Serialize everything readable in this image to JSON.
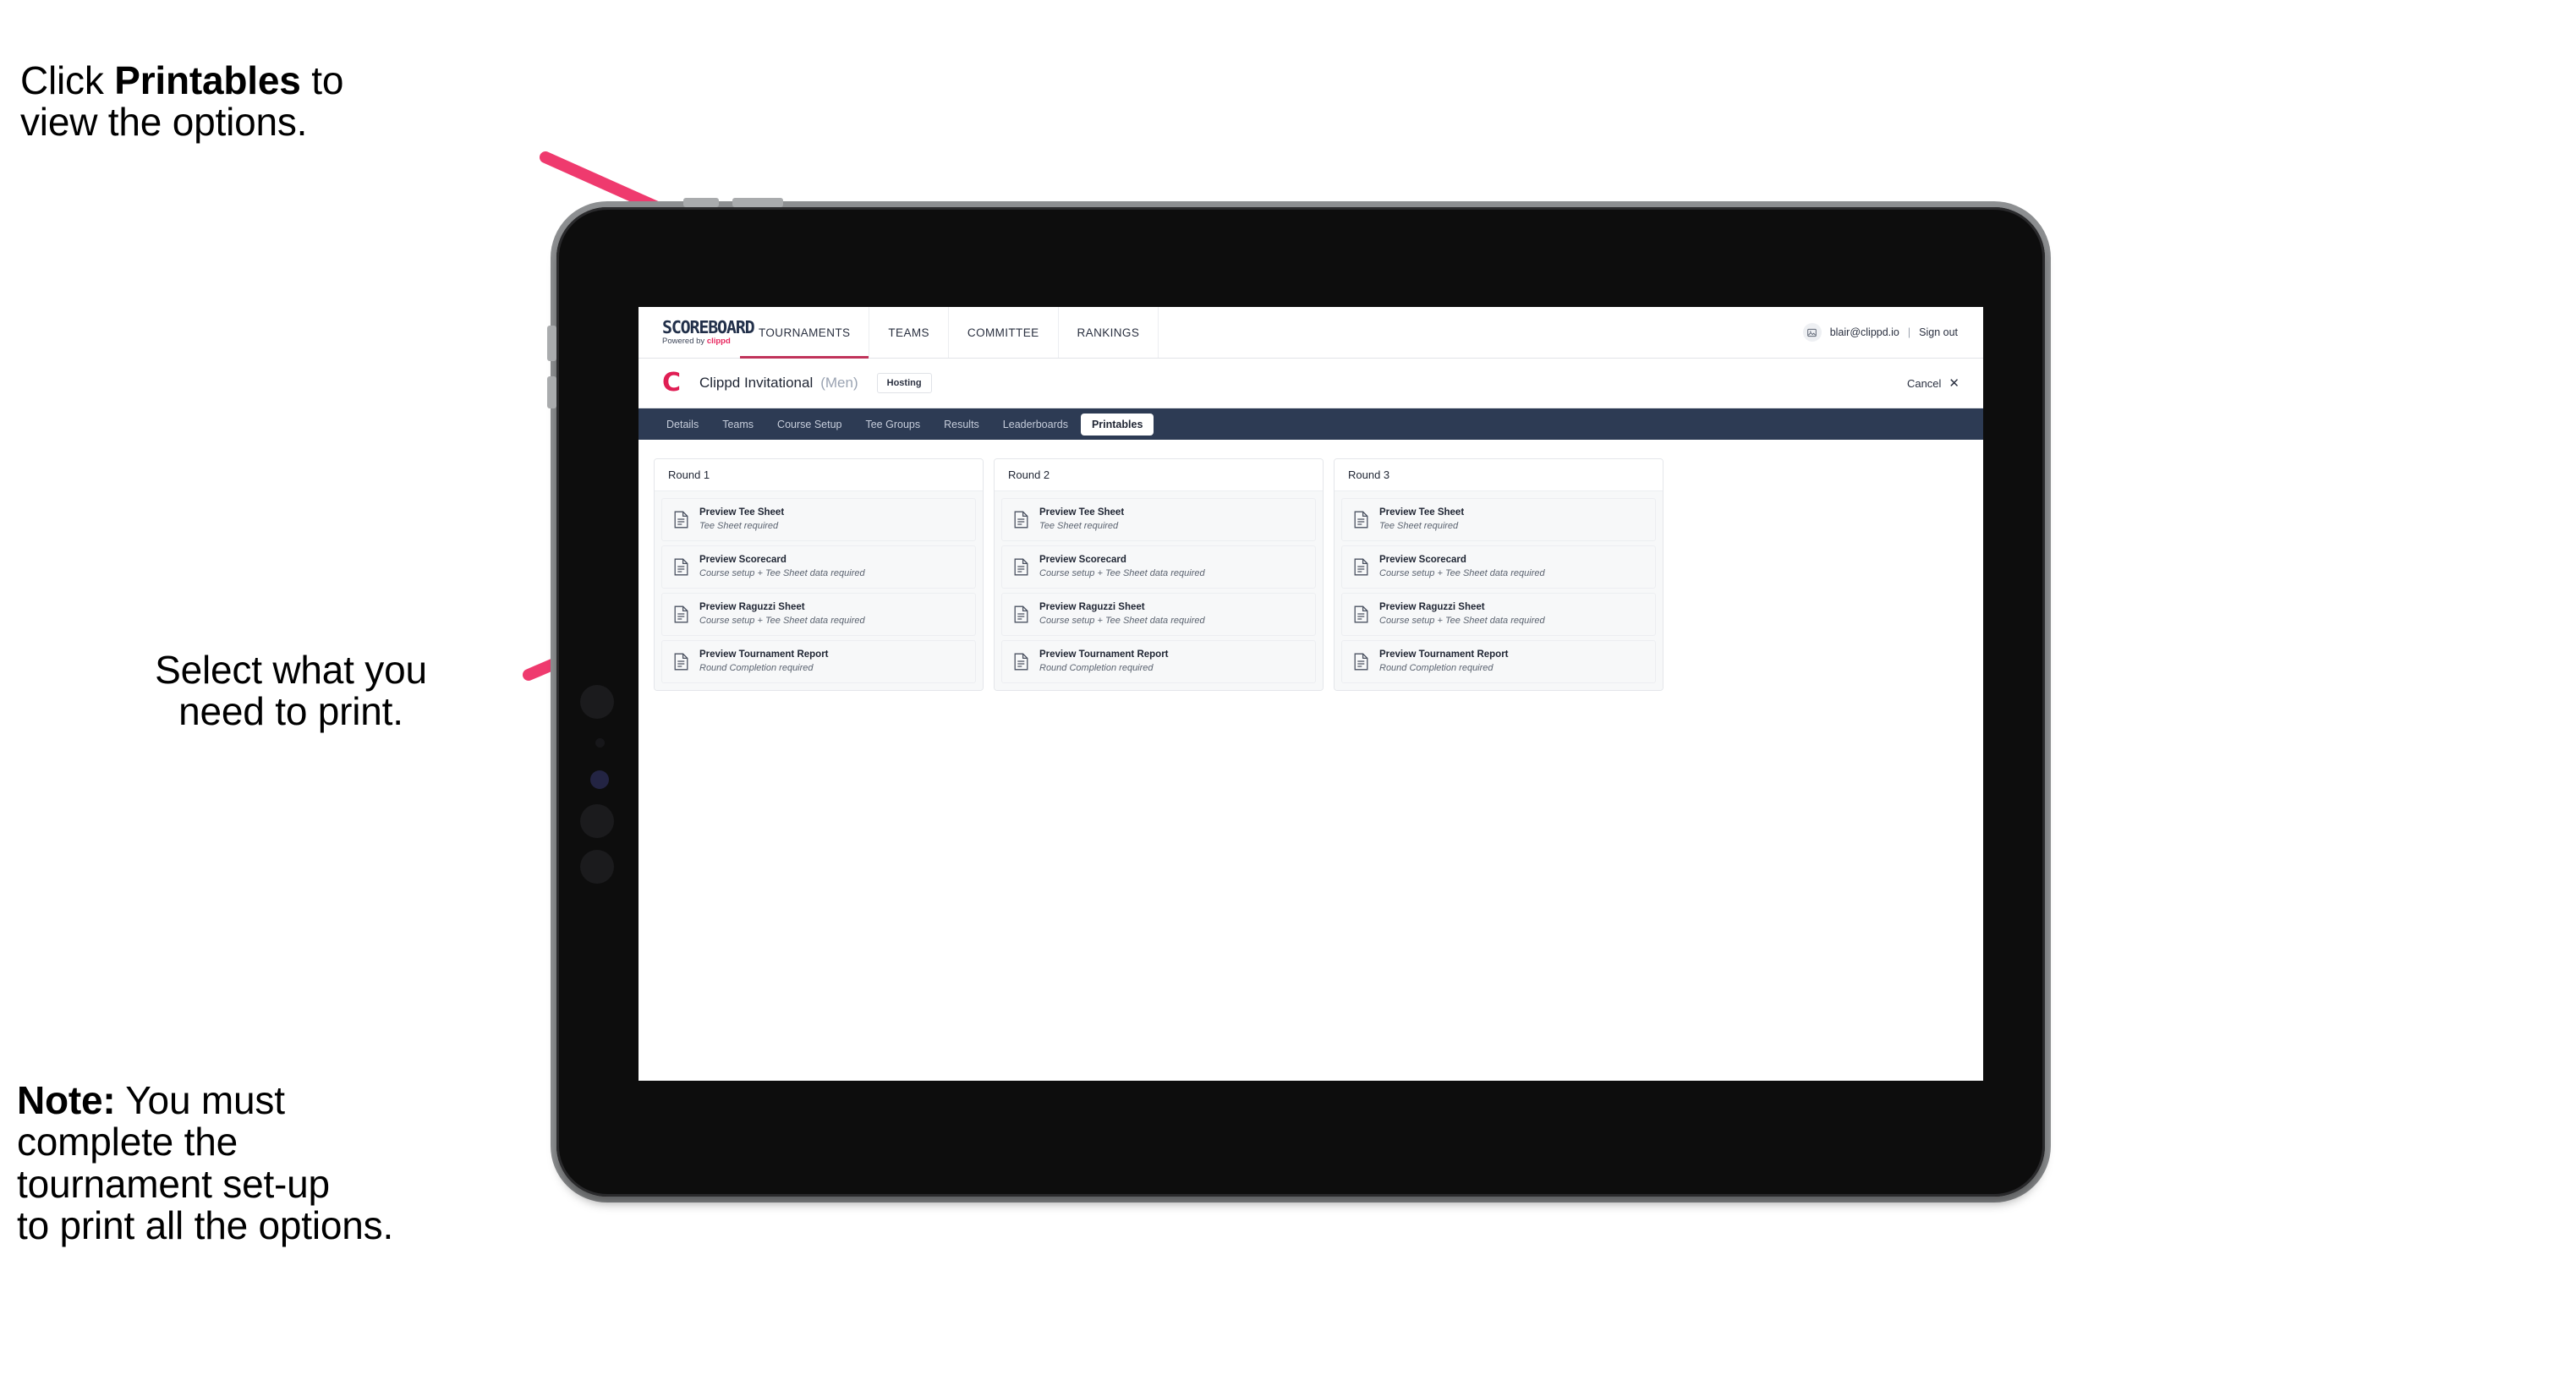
{
  "annotations": {
    "click": {
      "prefix": "Click ",
      "bold": "Printables",
      "suffix": " to\nview the options."
    },
    "select": "Select what you\nneed to print.",
    "note": {
      "bold": "Note:",
      "rest": " You must\ncomplete the\ntournament set-up\nto print all the options."
    }
  },
  "colors": {
    "accent_pink": "#e8275f",
    "arrow_pink": "#ef3a6e",
    "navy": "#2d3b54",
    "brand_red": "#e01e54",
    "underline_red": "#c0335a"
  },
  "app": {
    "brand": {
      "title": "SCOREBOARD",
      "powered_prefix": "Powered by ",
      "powered_name": "clippd"
    },
    "topnav": [
      {
        "label": "TOURNAMENTS",
        "active": true
      },
      {
        "label": "TEAMS",
        "active": false
      },
      {
        "label": "COMMITTEE",
        "active": false
      },
      {
        "label": "RANKINGS",
        "active": false
      }
    ],
    "user": {
      "avatar_initial": "B",
      "email": "blair@clippd.io",
      "separator": "|",
      "signout": "Sign out"
    },
    "titlebar": {
      "logo_letter": "C",
      "tournament_name": "Clippd Invitational",
      "gender": "(Men)",
      "badge": "Hosting",
      "cancel_label": "Cancel",
      "cancel_icon": "✕"
    },
    "subtabs": [
      {
        "label": "Details",
        "active": false
      },
      {
        "label": "Teams",
        "active": false
      },
      {
        "label": "Course Setup",
        "active": false
      },
      {
        "label": "Tee Groups",
        "active": false
      },
      {
        "label": "Results",
        "active": false
      },
      {
        "label": "Leaderboards",
        "active": false
      },
      {
        "label": "Printables",
        "active": true
      }
    ],
    "rounds": [
      {
        "header": "Round 1",
        "items": [
          {
            "title": "Preview Tee Sheet",
            "sub": "Tee Sheet required"
          },
          {
            "title": "Preview Scorecard",
            "sub": "Course setup + Tee Sheet data required"
          },
          {
            "title": "Preview Raguzzi Sheet",
            "sub": "Course setup + Tee Sheet data required"
          },
          {
            "title": "Preview Tournament Report",
            "sub": "Round Completion required"
          }
        ]
      },
      {
        "header": "Round 2",
        "items": [
          {
            "title": "Preview Tee Sheet",
            "sub": "Tee Sheet required"
          },
          {
            "title": "Preview Scorecard",
            "sub": "Course setup + Tee Sheet data required"
          },
          {
            "title": "Preview Raguzzi Sheet",
            "sub": "Course setup + Tee Sheet data required"
          },
          {
            "title": "Preview Tournament Report",
            "sub": "Round Completion required"
          }
        ]
      },
      {
        "header": "Round 3",
        "items": [
          {
            "title": "Preview Tee Sheet",
            "sub": "Tee Sheet required"
          },
          {
            "title": "Preview Scorecard",
            "sub": "Course setup + Tee Sheet data required"
          },
          {
            "title": "Preview Raguzzi Sheet",
            "sub": "Course setup + Tee Sheet data required"
          },
          {
            "title": "Preview Tournament Report",
            "sub": "Round Completion required"
          }
        ]
      }
    ]
  }
}
